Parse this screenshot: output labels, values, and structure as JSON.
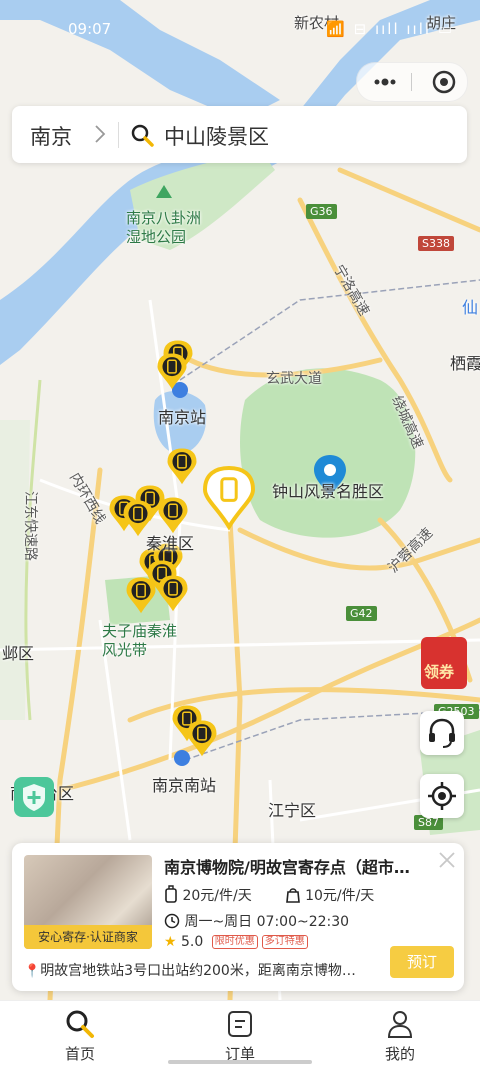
{
  "status_bar": {
    "time": "09:07",
    "right": "📶 ⊟ ııll ııll ▭"
  },
  "search": {
    "city": "南京",
    "query": "中山陵景区"
  },
  "map": {
    "places": [
      "新农村",
      "胡庄",
      "南京八卦洲\n湿地公园",
      "南京站",
      "玄武大道",
      "钟山风景名胜区",
      "秦淮区",
      "夫子庙秦淮\n风光带",
      "南京南站",
      "江宁区",
      "栖霞",
      "仙",
      "邺区",
      "南京台区",
      "内环西线",
      "江东快速路",
      "宁洛高速",
      "绕城高速",
      "沪蓉高速"
    ],
    "shields": [
      "G36",
      "S338",
      "G42",
      "G2503",
      "S87"
    ]
  },
  "side": {
    "coupon_label": "领券"
  },
  "card": {
    "title": "南京博物院/明故宫寄存点（超市…",
    "verified_badge": "安心寄存·认证商家",
    "price_large": "20元/件/天",
    "price_small": "10元/件/天",
    "hours": "周一~周日 07:00~22:30",
    "rating": "5.0",
    "tags": [
      "限时优惠",
      "多订特惠"
    ],
    "address": "明故宫地铁站3号口出站约200米，距离南京博物…",
    "book_label": "预订"
  },
  "tabs": [
    {
      "label": "首页",
      "icon": "search-icon"
    },
    {
      "label": "订单",
      "icon": "order-icon"
    },
    {
      "label": "我的",
      "icon": "user-icon"
    }
  ],
  "colors": {
    "accent": "#f6cc42",
    "river": "#a9cdf0",
    "park": "#bfe3b6",
    "road": "#f7d27e"
  }
}
